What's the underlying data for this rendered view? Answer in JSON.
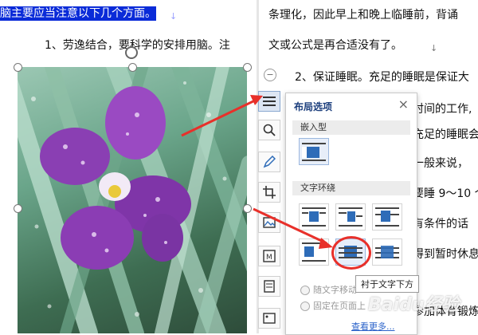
{
  "left_doc": {
    "line1_highlight": "脑主要应当注意以下几个方面。",
    "para_mark": "↓",
    "line2": "1、劳逸结合，要科学的安排用脑。注"
  },
  "right_doc": {
    "line1": "条理化，因此早上和晚上临睡前，背诵",
    "line2": "文或公式是再合适没有了。",
    "para_mark": "↓",
    "line3": "2、保证睡眠。充足的睡眠是保证大",
    "frag1": "时间的工作,",
    "frag2": "充足的睡眠会",
    "frag3": "一般来说，",
    "frag4": "要睡 9～10 个",
    "frag5": "有条件的话",
    "frag6": "得到暂时休息",
    "frag7": "参加体育锻炼"
  },
  "popup": {
    "title": "布局选项",
    "close": "×",
    "section_inline": "嵌入型",
    "section_wrap": "文字环绕",
    "option_move": "随文字移动",
    "option_fixed": "固定在页面上",
    "see_more": "查看更多...",
    "tooltip": "衬于文字下方"
  },
  "watermark": "Baidu经验",
  "colors": {
    "highlight": "#0a2bd8",
    "accent": "#1a3d7c",
    "arrow": "#e8302a",
    "icon_blue": "#2e6cb8"
  }
}
